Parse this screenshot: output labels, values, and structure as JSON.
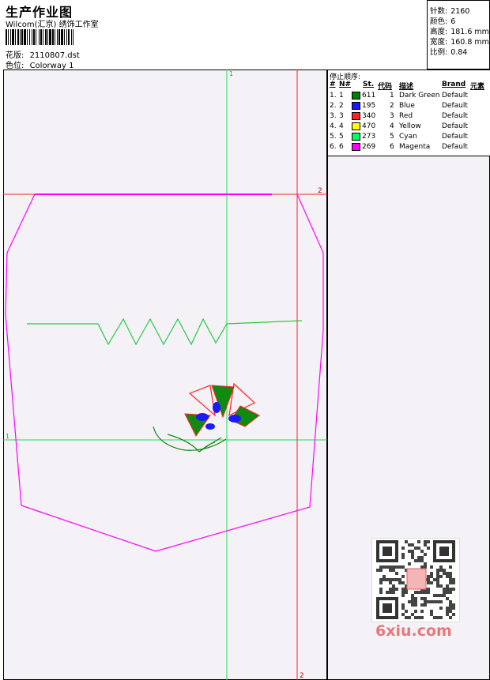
{
  "header": {
    "title": "生产作业图",
    "company": "Wilcom(汇京) 绣饰工作室",
    "design_label": "花版:",
    "design_value": "2110807.dst",
    "colorway_label": "色位:",
    "colorway_value": "Colorway 1"
  },
  "stats": [
    {
      "label": "针数:",
      "value": "2160"
    },
    {
      "label": "颜色:",
      "value": "6"
    },
    {
      "label": "高度:",
      "value": "181.6 mm"
    },
    {
      "label": "宽度:",
      "value": "160.8 mm"
    },
    {
      "label": "比例:",
      "value": "0.84"
    }
  ],
  "guides": {
    "v1": "1",
    "h1": "1",
    "v2": "2",
    "h2": "2"
  },
  "table": {
    "title": "停止顺序:",
    "columns": [
      "#",
      "N#",
      "St.",
      "代码",
      "描述",
      "Brand",
      "元素"
    ],
    "rows": [
      {
        "idx": "1.",
        "n": "1",
        "color": "#008000",
        "st": "611",
        "code": "1",
        "desc": "Dark Green",
        "brand": "Default"
      },
      {
        "idx": "2.",
        "n": "2",
        "color": "#1a1aff",
        "st": "195",
        "code": "2",
        "desc": "Blue",
        "brand": "Default"
      },
      {
        "idx": "3.",
        "n": "3",
        "color": "#ff2020",
        "st": "340",
        "code": "3",
        "desc": "Red",
        "brand": "Default"
      },
      {
        "idx": "4.",
        "n": "4",
        "color": "#ffff00",
        "st": "470",
        "code": "4",
        "desc": "Yellow",
        "brand": "Default"
      },
      {
        "idx": "5.",
        "n": "5",
        "color": "#00ff66",
        "st": "273",
        "code": "5",
        "desc": "Cyan",
        "brand": "Default"
      },
      {
        "idx": "6.",
        "n": "6",
        "color": "#ff00ff",
        "st": "269",
        "code": "6",
        "desc": "Magenta",
        "brand": "Default"
      }
    ]
  },
  "watermark": {
    "logo": "6xiu.com"
  }
}
